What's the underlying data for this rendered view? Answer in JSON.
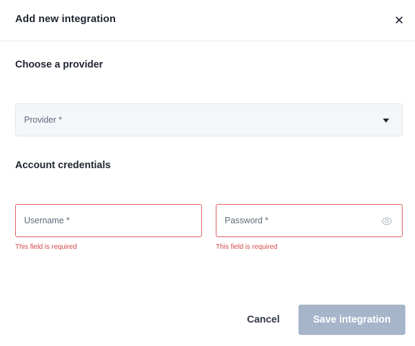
{
  "dialog": {
    "title": "Add new integration",
    "close_icon": "close-icon"
  },
  "provider_section": {
    "title": "Choose a provider",
    "select": {
      "placeholder": "Provider *",
      "selected": "",
      "icon": "chevron-down-icon"
    }
  },
  "credentials_section": {
    "title": "Account credentials",
    "username": {
      "placeholder": "Username *",
      "value": "",
      "error": "This field is required"
    },
    "password": {
      "placeholder": "Password *",
      "value": "",
      "error": "This field is required",
      "icon": "eye-icon"
    }
  },
  "footer": {
    "cancel_label": "Cancel",
    "save_label": "Save integration"
  },
  "colors": {
    "error": "#d64545",
    "error_border": "#e05d5d",
    "save_disabled": "#a7b5ca",
    "select_bg": "#f4f6f9"
  }
}
